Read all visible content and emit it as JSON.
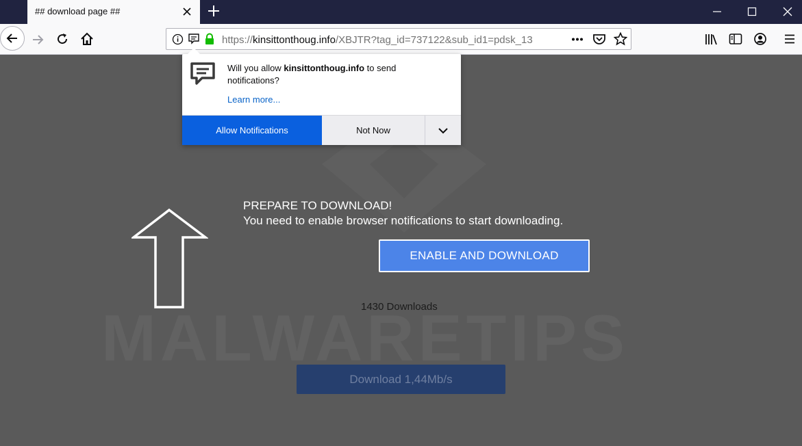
{
  "tab": {
    "title": "## download page ##"
  },
  "url": {
    "scheme": "https://",
    "host": "kinsittonthoug.info",
    "path": "/XBJTR?tag_id=737122&sub_id1=pdsk_13"
  },
  "popup": {
    "message_prefix": "Will you allow ",
    "message_host": "kinsittonthoug.info",
    "message_suffix": " to send notifications?",
    "learn_more": "Learn more...",
    "allow_label": "Allow Notifications",
    "not_now_label": "Not Now"
  },
  "page": {
    "watermark": "MALWARETIPS",
    "headline": "PREPARE TO DOWNLOAD!",
    "subline": "You need to enable browser notifications to start downloading.",
    "enable_button": "ENABLE AND DOWNLOAD",
    "downloads_count": "1430 Downloads",
    "download_bar": "Download 1,44Mb/s"
  },
  "colors": {
    "tabbar": "#202340",
    "page_bg": "#5a5a5a",
    "accent_blue": "#0a60df",
    "enable_blue": "#4c84e8"
  }
}
